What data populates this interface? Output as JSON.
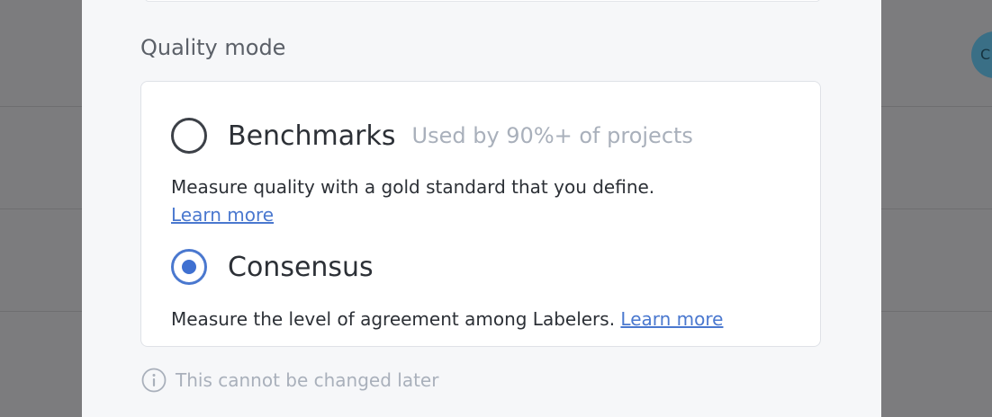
{
  "background": {
    "avatar_initial": "C"
  },
  "quality": {
    "section_label": "Quality mode",
    "options": [
      {
        "title": "Benchmarks",
        "hint": "Used by 90%+ of projects",
        "description": "Measure quality with a gold standard that you define.",
        "link": "Learn more",
        "selected": false
      },
      {
        "title": "Consensus",
        "hint": "",
        "description": "Measure the level of agreement among Labelers.",
        "link": "Learn more",
        "selected": true
      }
    ],
    "note": "This cannot be changed later"
  },
  "colors": {
    "accent": "#4a78cf",
    "overlay": "#7c7c7e",
    "muted_text": "#a9b0bb"
  }
}
